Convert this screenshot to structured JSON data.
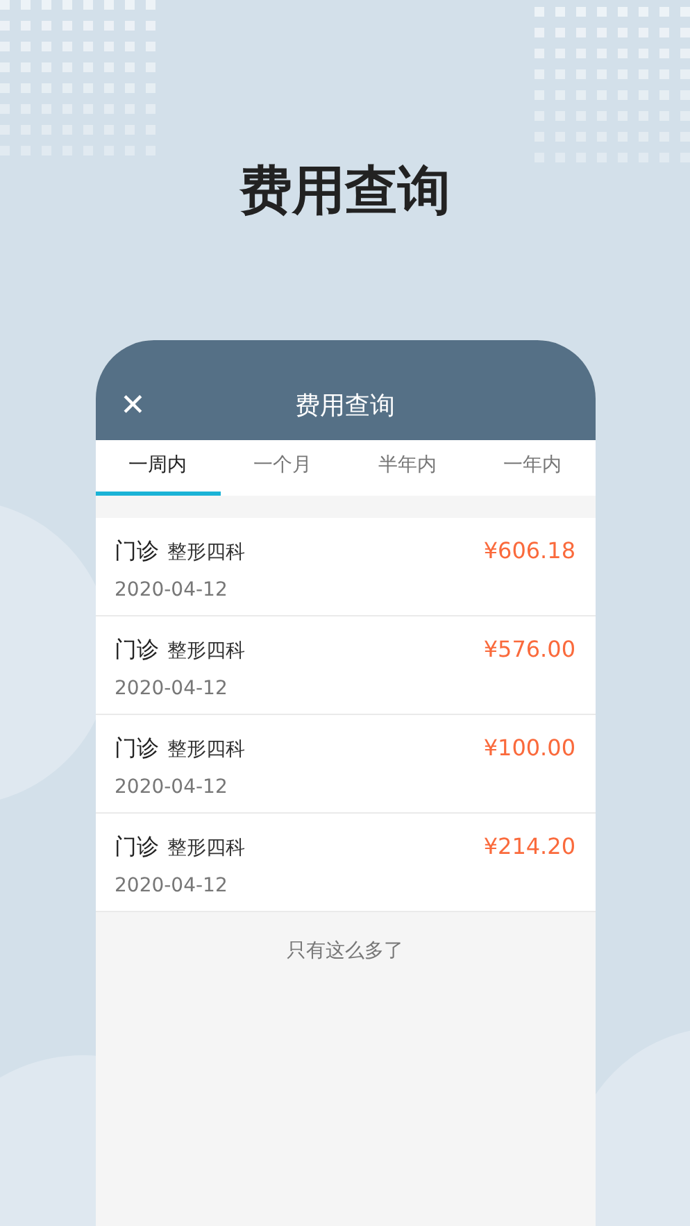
{
  "headline": "费用查询",
  "header": {
    "close": "✕",
    "title": "费用查询"
  },
  "tabs": [
    {
      "label": "一周内",
      "selected": true
    },
    {
      "label": "一个月",
      "selected": false
    },
    {
      "label": "半年内",
      "selected": false
    },
    {
      "label": "一年内",
      "selected": false
    }
  ],
  "records": [
    {
      "visit": "门诊",
      "department": "整形四科",
      "amount": "¥606.18",
      "date": "2020-04-12"
    },
    {
      "visit": "门诊",
      "department": "整形四科",
      "amount": "¥576.00",
      "date": "2020-04-12"
    },
    {
      "visit": "门诊",
      "department": "整形四科",
      "amount": "¥100.00",
      "date": "2020-04-12"
    },
    {
      "visit": "门诊",
      "department": "整形四科",
      "amount": "¥214.20",
      "date": "2020-04-12"
    }
  ],
  "end_note": "只有这么多了"
}
